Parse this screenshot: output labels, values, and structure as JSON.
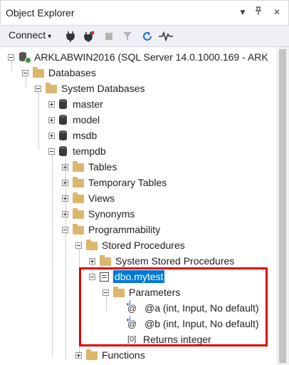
{
  "window": {
    "title": "Object Explorer"
  },
  "toolbar": {
    "connect_label": "Connect"
  },
  "tree": {
    "server": "ARKLABWIN2016 (SQL Server 14.0.1000.169 - ARK",
    "databases": "Databases",
    "system_databases": "System Databases",
    "master": "master",
    "model": "model",
    "msdb": "msdb",
    "tempdb": "tempdb",
    "tables": "Tables",
    "temporary_tables": "Temporary Tables",
    "views": "Views",
    "synonyms": "Synonyms",
    "programmability": "Programmability",
    "stored_procedures": "Stored Procedures",
    "system_stored_procedures": "System Stored Procedures",
    "proc": "dbo.mytest",
    "parameters": "Parameters",
    "param_a": "@a (int, Input, No default)",
    "param_b": "@b (int, Input, No default)",
    "returns": "Returns integer",
    "functions": "Functions"
  },
  "icons": {
    "at_symbol": "@",
    "return_symbol": "[0]"
  },
  "colors": {
    "selection": "#0078d7",
    "highlight_box": "#e00000",
    "folder": "#dcb66b"
  }
}
